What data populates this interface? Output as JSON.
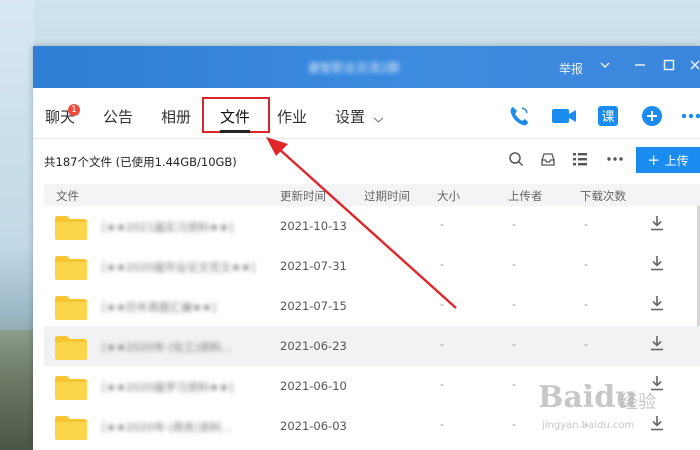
{
  "window": {
    "title_blurred": "睿智职业交流2群",
    "report_label": "举报"
  },
  "tabs": [
    {
      "label": "聊天",
      "badge": "1"
    },
    {
      "label": "公告"
    },
    {
      "label": "相册"
    },
    {
      "label": "文件",
      "selected": true
    },
    {
      "label": "作业"
    },
    {
      "label": "设置",
      "has_dropdown": true
    }
  ],
  "right_icons": [
    "phone-icon",
    "video-icon",
    "lesson-icon",
    "add-icon",
    "more-icon"
  ],
  "toolbar": {
    "file_summary": "共187个文件 (已使用1.44GB/10GB)",
    "upload_label": "上传"
  },
  "table": {
    "columns": [
      "文件",
      "更新时间",
      "过期时间",
      "大小",
      "上传者",
      "下载次数"
    ],
    "rows": [
      {
        "name": "[★★2021届实习资料★★]",
        "date": "2021-10-13",
        "size": "-",
        "uploader": "-",
        "downloads": "-"
      },
      {
        "name": "[★★2020届毕业论文范文★★]",
        "date": "2021-07-31",
        "size": "-",
        "uploader": "-",
        "downloads": "-"
      },
      {
        "name": "[★★历年真题汇编★★]",
        "date": "2021-07-15",
        "size": "-",
        "uploader": "-",
        "downloads": "-"
      },
      {
        "name": "[★★2020年·(化工)资料...",
        "date": "2021-06-23",
        "size": "-",
        "uploader": "-",
        "downloads": "-"
      },
      {
        "name": "[★★2020届学习资料★★]",
        "date": "2021-06-10",
        "size": "-",
        "uploader": "-",
        "downloads": "-"
      },
      {
        "name": "[★★2020年·(商务)资料...",
        "date": "2021-06-03",
        "size": "-",
        "uploader": "-",
        "downloads": "-"
      }
    ]
  },
  "watermark": {
    "brand": "Baidu",
    "cn": "经验",
    "url": "jingyan.baidu.com"
  },
  "colors": {
    "accent": "#1a8cf0",
    "titlebar": "#3a86dc",
    "highlight_box": "#d9262a",
    "folder": "#f7c531"
  }
}
